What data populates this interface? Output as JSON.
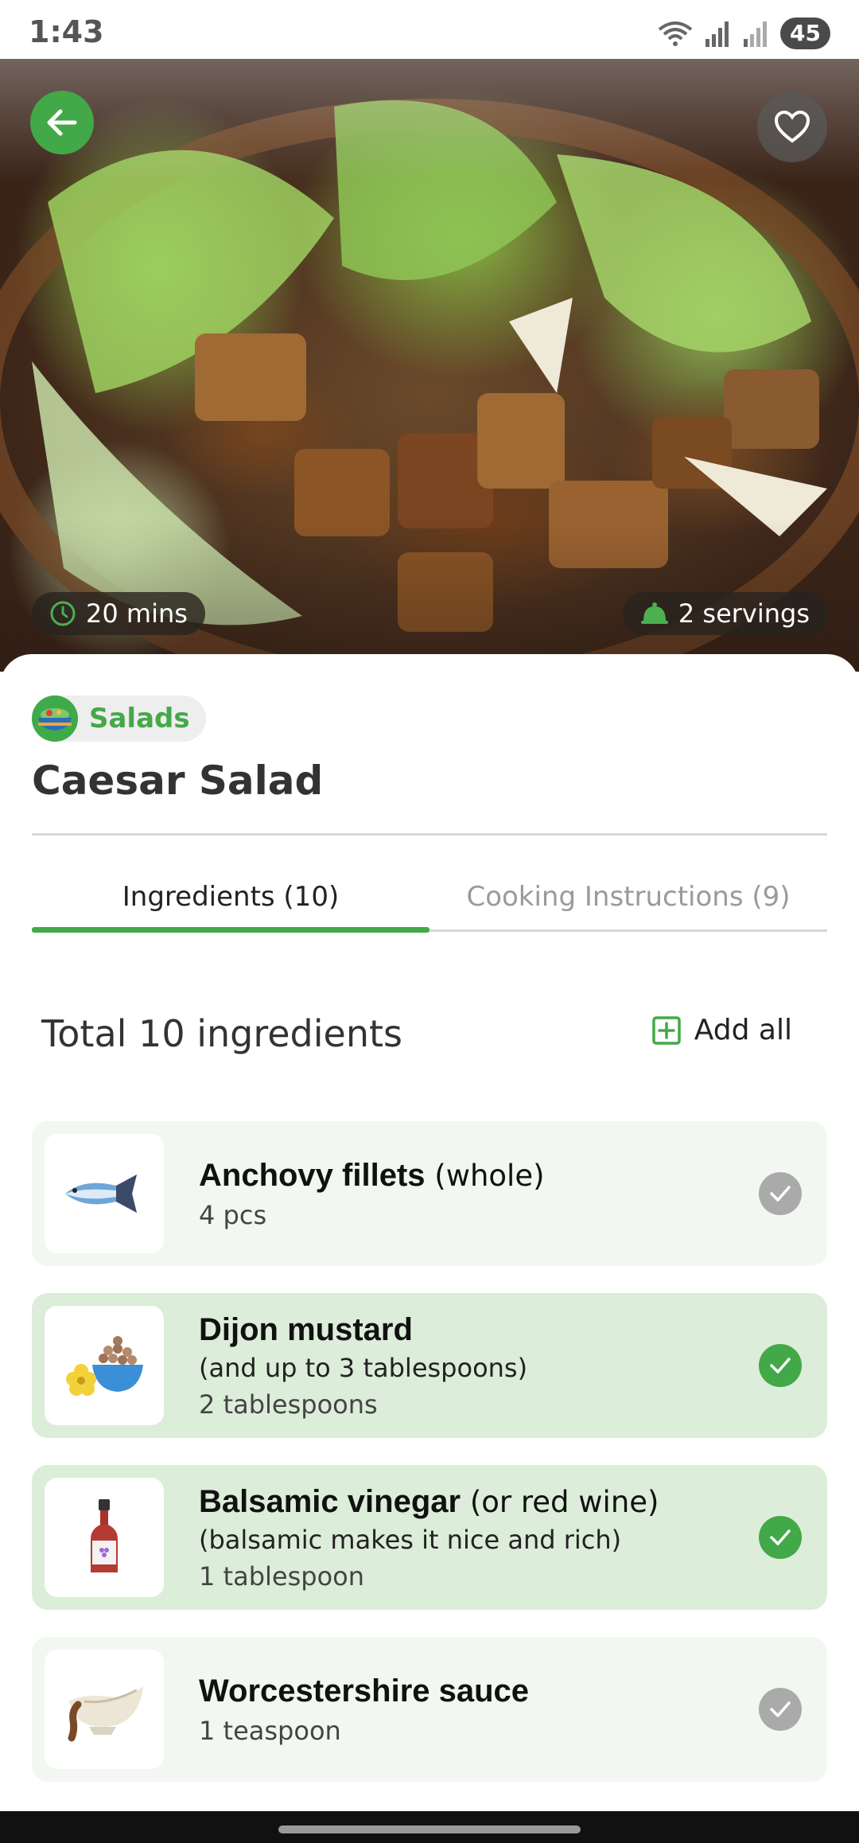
{
  "status_bar": {
    "time": "1:43",
    "battery": "45"
  },
  "recipe": {
    "prep_time": "20 mins",
    "servings": "2 servings",
    "category": "Salads",
    "title": "Caesar Salad"
  },
  "tabs": [
    {
      "label": "Ingredients (10)",
      "active": true
    },
    {
      "label": "Cooking Instructions (9)",
      "active": false
    }
  ],
  "ingredients_header": {
    "total": "Total 10 ingredients",
    "add_all": "Add all"
  },
  "ingredients": [
    {
      "name": "Anchovy fillets",
      "qualifier": " (whole)",
      "note": "",
      "quantity": "4 pcs",
      "checked": false,
      "icon": "fish-icon"
    },
    {
      "name": "Dijon mustard",
      "qualifier": "",
      "note": "(and up to 3 tablespoons)",
      "quantity": "2 tablespoons",
      "checked": true,
      "icon": "mustard-bowl-icon"
    },
    {
      "name": "Balsamic vinegar",
      "qualifier": " (or red wine)",
      "note": "(balsamic makes it nice and rich)",
      "quantity": "1 tablespoon",
      "checked": true,
      "icon": "vinegar-bottle-icon"
    },
    {
      "name": "Worcestershire sauce",
      "qualifier": "",
      "note": "",
      "quantity": "1 teaspoon",
      "checked": false,
      "icon": "sauce-boat-icon"
    }
  ],
  "colors": {
    "accent": "#43a847",
    "checked_bg": "#dcedd9",
    "unchecked_bg": "#f2f7f1",
    "check_off": "#aaaaaa"
  }
}
